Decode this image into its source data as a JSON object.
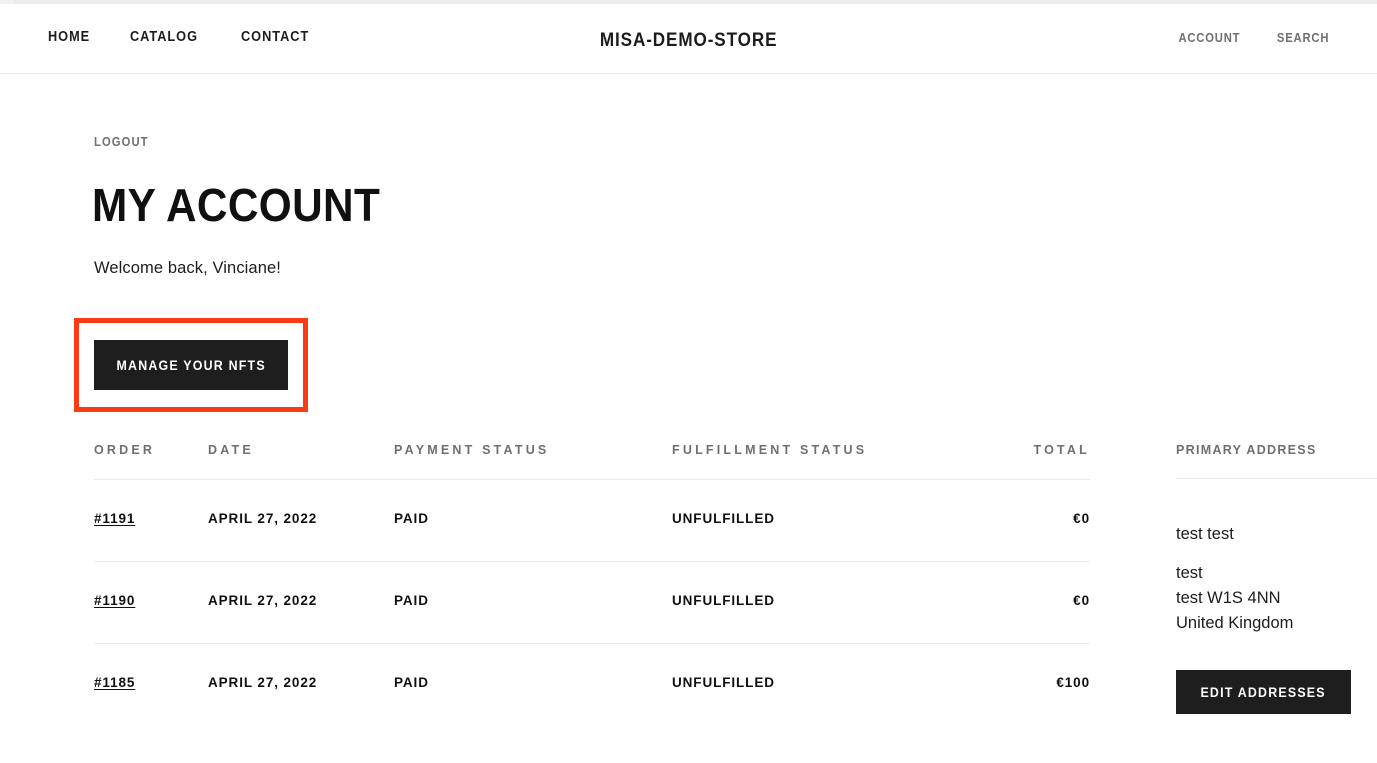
{
  "header": {
    "nav_left": [
      {
        "label": "Home",
        "name": "nav-link-home"
      },
      {
        "label": "Catalog",
        "name": "nav-link-catalog"
      },
      {
        "label": "Contact",
        "name": "nav-link-contact"
      }
    ],
    "store_title": "MISA-DEMO-STORE",
    "nav_right": [
      {
        "label": "Account",
        "name": "nav-link-account"
      },
      {
        "label": "Search",
        "name": "nav-link-search"
      }
    ]
  },
  "account": {
    "logout_label": "Logout",
    "page_title": "My Account",
    "welcome_text": "Welcome back, Vinciane!",
    "manage_nfts_button": "Manage your NFTs"
  },
  "orders": {
    "columns": [
      {
        "key": "order",
        "label": "Order"
      },
      {
        "key": "date",
        "label": "Date"
      },
      {
        "key": "payment_status",
        "label": "Payment status"
      },
      {
        "key": "fulfillment_status",
        "label": "Fulfillment status"
      },
      {
        "key": "total",
        "label": "Total"
      }
    ],
    "rows": [
      {
        "order": "#1191",
        "date": "April 27, 2022",
        "payment_status": "Paid",
        "fulfillment_status": "Unfulfilled",
        "total": "€0"
      },
      {
        "order": "#1190",
        "date": "April 27, 2022",
        "payment_status": "Paid",
        "fulfillment_status": "Unfulfilled",
        "total": "€0"
      },
      {
        "order": "#1185",
        "date": "April 27, 2022",
        "payment_status": "Paid",
        "fulfillment_status": "Unfulfilled",
        "total": "€100"
      }
    ]
  },
  "primary_address": {
    "heading": "Primary Address",
    "name": "test test",
    "lines": [
      "test",
      "test W1S 4NN",
      "United Kingdom"
    ],
    "edit_button": "Edit addresses"
  },
  "highlight": {
    "color": "#fa3c14",
    "target": "manage-nfts-button"
  },
  "colors": {
    "text_primary": "#101010",
    "text_muted": "#6f6f6f",
    "button_bg": "#1e1e1e",
    "border": "#e9e9e9",
    "background": "#ffffff"
  }
}
